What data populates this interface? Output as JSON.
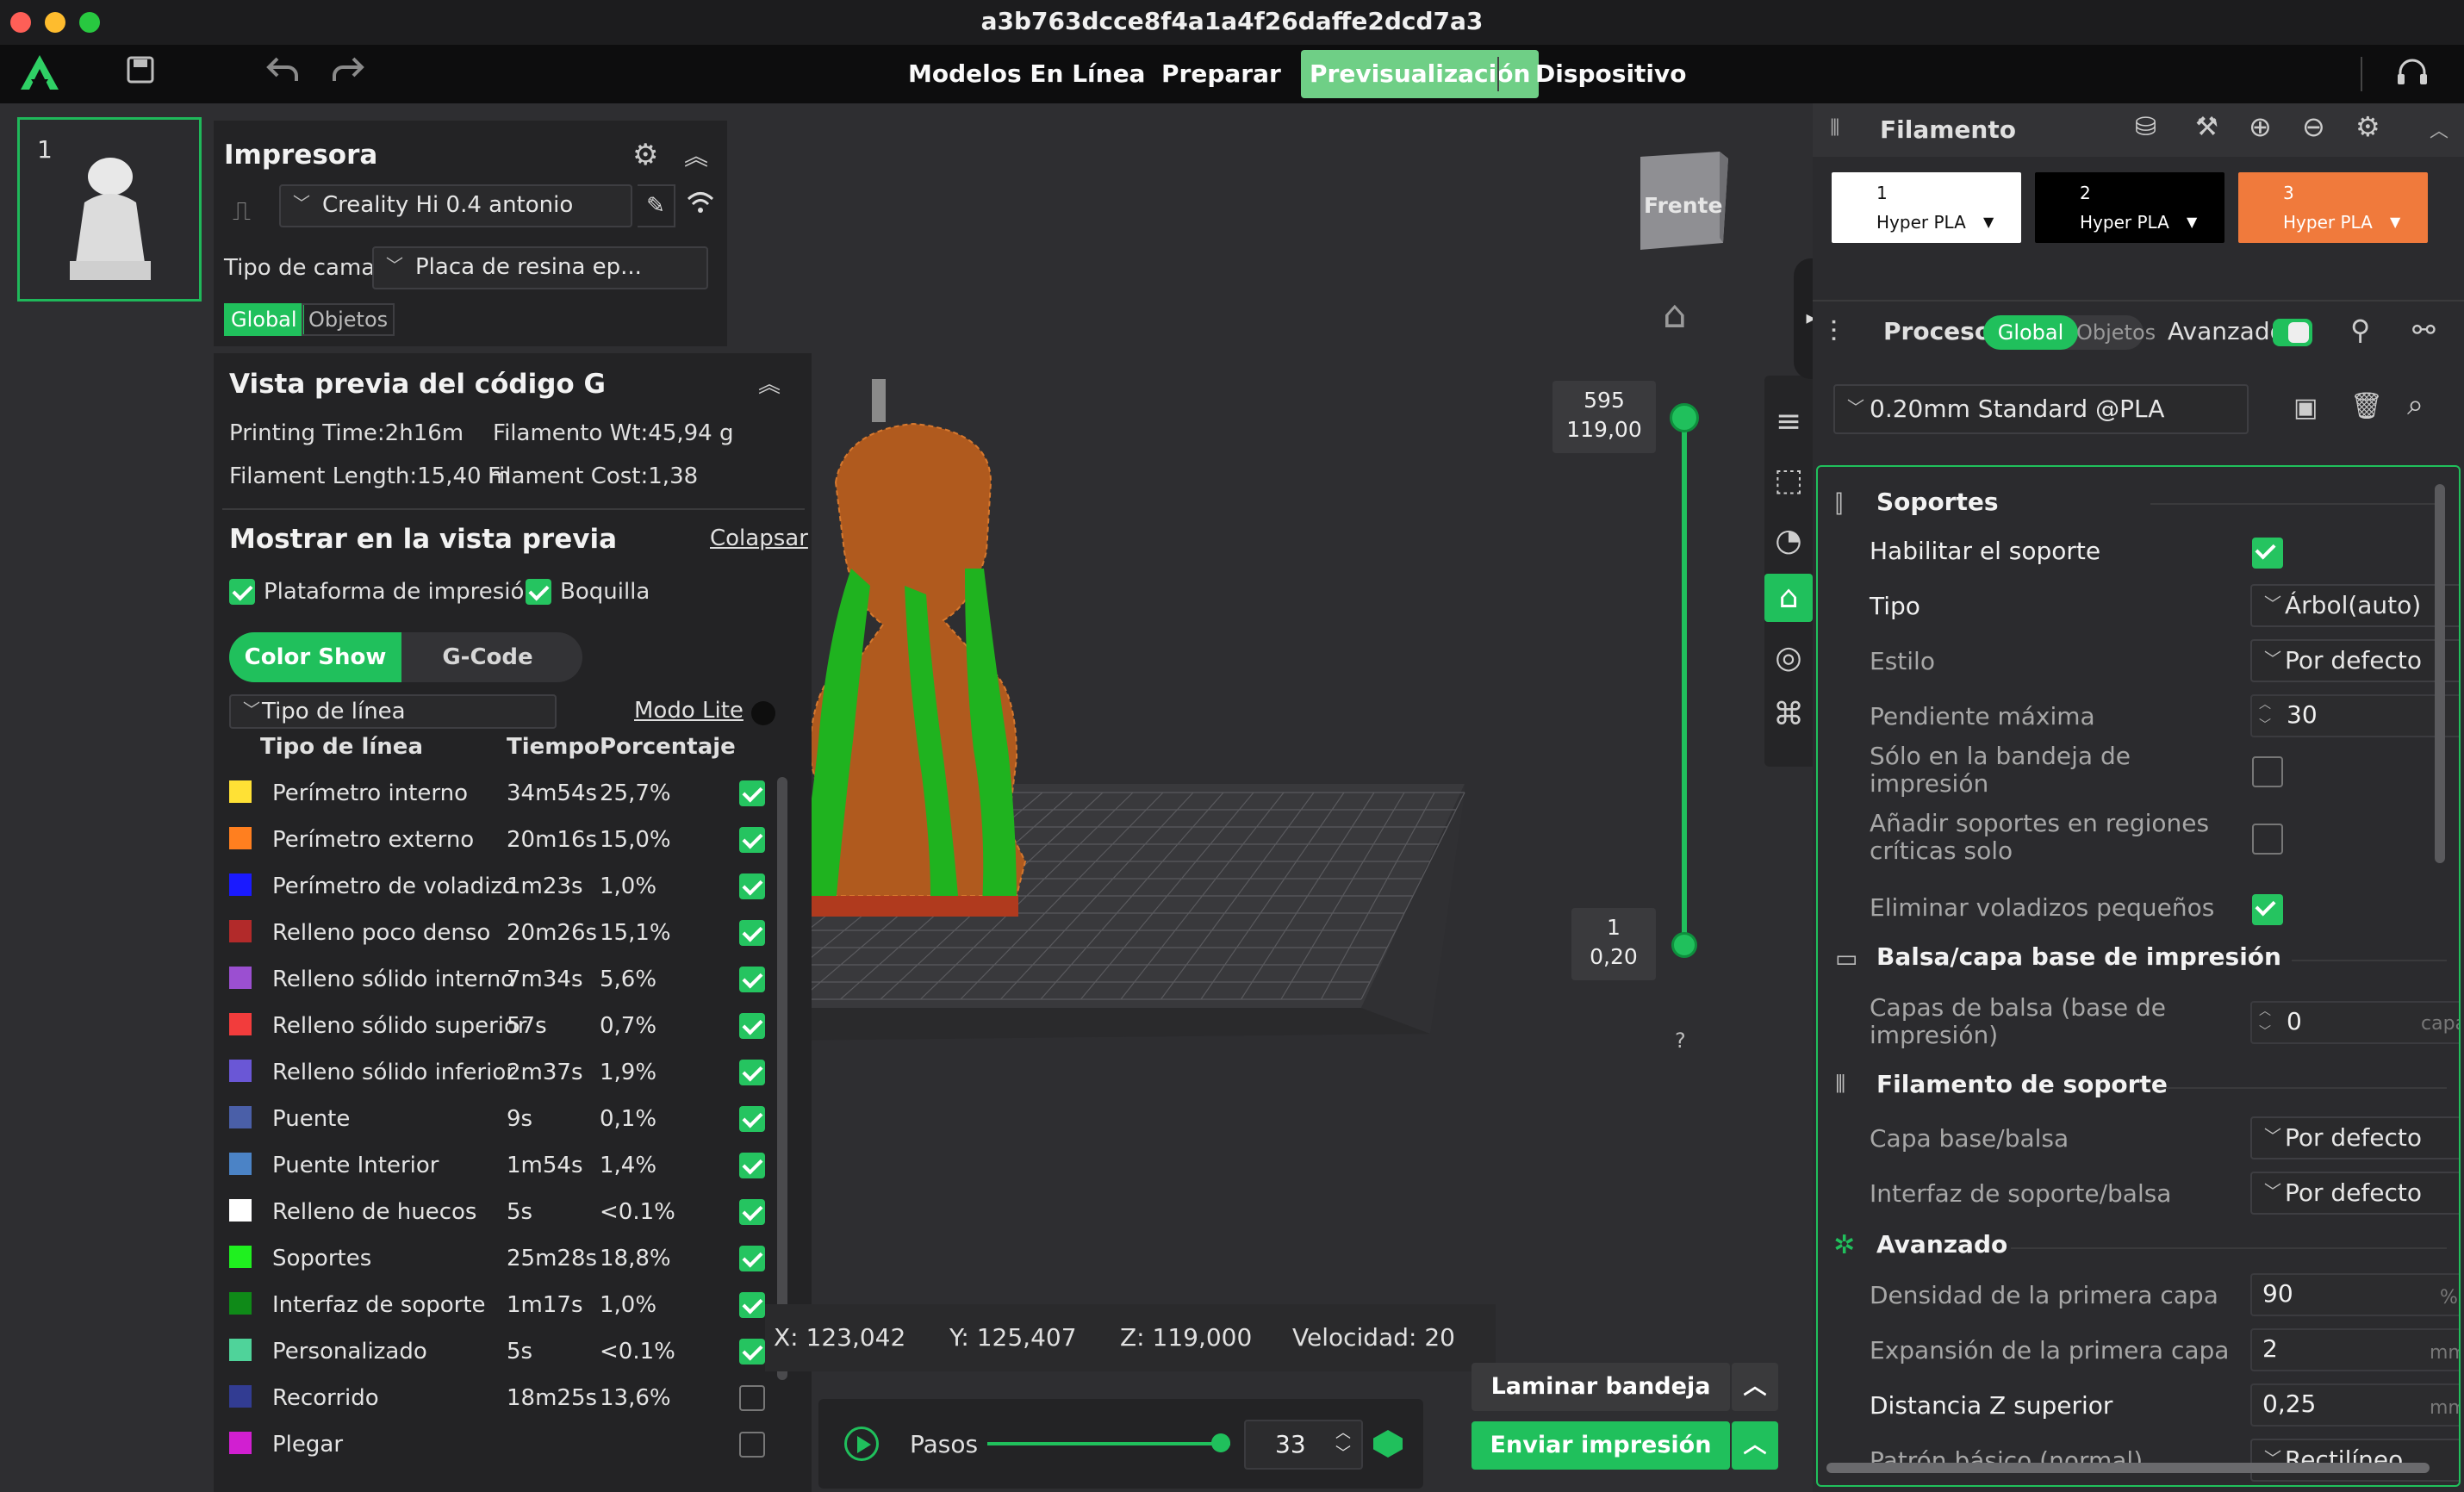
{
  "window": {
    "title": "a3b763dcce8f4a1a4f26daffe2dcd7a3"
  },
  "toolbar": {
    "tabs": [
      "Modelos En Línea",
      "Preparar",
      "Previsualización",
      "Dispositivo"
    ],
    "active_tab": "Previsualización"
  },
  "plates": [
    {
      "number": "1"
    }
  ],
  "printer": {
    "title": "Impresora",
    "name": "Creality Hi 0.4 antonio",
    "bed_label": "Tipo de cama",
    "bed_value": "Placa de resina ep...",
    "scope_tabs": [
      "Global",
      "Objetos"
    ]
  },
  "gcode": {
    "title": "Vista previa del código G",
    "printing_time": "Printing Time:2h16m",
    "filament_wt": "Filamento Wt:45,94 g",
    "filament_length": "Filament Length:15,40 m",
    "filament_cost": "Filament Cost:1,38",
    "show_title": "Mostrar en la vista previa",
    "collapse": "Colapsar",
    "show_bed": "Plataforma de impresión",
    "show_nozzle": "Boquilla",
    "mode_tabs": [
      "Color Show",
      "G-Code"
    ],
    "line_type_combo": "Tipo de línea",
    "lite_mode": "Modo Lite",
    "columns": [
      "Tipo de línea",
      "Tiempo",
      "Porcentaje"
    ],
    "rows": [
      {
        "color": "#ffe135",
        "name": "Perímetro interno",
        "time": "34m54s",
        "pct": "25,7%",
        "on": true
      },
      {
        "color": "#ff7f1f",
        "name": "Perímetro externo",
        "time": "20m16s",
        "pct": "15,0%",
        "on": true
      },
      {
        "color": "#1a1aff",
        "name": "Perímetro de voladizo",
        "time": "1m23s",
        "pct": "1,0%",
        "on": true
      },
      {
        "color": "#b22a2a",
        "name": "Relleno poco denso",
        "time": "20m26s",
        "pct": "15,1%",
        "on": true
      },
      {
        "color": "#9b4fd1",
        "name": "Relleno sólido interno",
        "time": "7m34s",
        "pct": "5,6%",
        "on": true
      },
      {
        "color": "#f23c3c",
        "name": "Relleno sólido superior",
        "time": "57s",
        "pct": "0,7%",
        "on": true
      },
      {
        "color": "#6a57d6",
        "name": "Relleno sólido inferior",
        "time": "2m37s",
        "pct": "1,9%",
        "on": true
      },
      {
        "color": "#4a5fa8",
        "name": "Puente",
        "time": "9s",
        "pct": "0,1%",
        "on": true
      },
      {
        "color": "#4b83c6",
        "name": "Puente Interior",
        "time": "1m54s",
        "pct": "1,4%",
        "on": true
      },
      {
        "color": "#ffffff",
        "name": "Relleno de huecos",
        "time": "5s",
        "pct": "<0.1%",
        "on": true
      },
      {
        "color": "#1ff01f",
        "name": "Soportes",
        "time": "25m28s",
        "pct": "18,8%",
        "on": true
      },
      {
        "color": "#0f8a18",
        "name": "Interfaz de soporte",
        "time": "1m17s",
        "pct": "1,0%",
        "on": true
      },
      {
        "color": "#4fd39a",
        "name": "Personalizado",
        "time": "5s",
        "pct": "<0.1%",
        "on": true
      },
      {
        "color": "#323c92",
        "name": "Recorrido",
        "time": "18m25s",
        "pct": "13,6%",
        "on": false
      },
      {
        "color": "#d11fd1",
        "name": "Plegar",
        "time": "",
        "pct": "",
        "on": false
      }
    ]
  },
  "viewcube": {
    "label": "Frente"
  },
  "layer_slider": {
    "top_layer": "595",
    "top_height": "119,00",
    "bottom_layer": "1",
    "bottom_height": "0,20",
    "help": "?"
  },
  "status": {
    "x": "X: 123,042",
    "y": "Y: 125,407",
    "z": "Z: 119,000",
    "speed": "Velocidad: 20"
  },
  "playback": {
    "label": "Pasos",
    "value": "33"
  },
  "buttons": {
    "slice": "Laminar bandeja",
    "send": "Enviar impresión"
  },
  "filament": {
    "title": "Filamento",
    "slots": [
      {
        "num": "1",
        "type": "Hyper PLA",
        "bg": "#ffffff",
        "fg": "#111111"
      },
      {
        "num": "2",
        "type": "Hyper PLA",
        "bg": "#000000",
        "fg": "#ffffff"
      },
      {
        "num": "3",
        "type": "Hyper PLA",
        "bg": "#f07a3c",
        "fg": "#ffffff"
      }
    ]
  },
  "process": {
    "title": "Proceso",
    "tabs": [
      "Global",
      "Objetos"
    ],
    "advanced": "Avanzado",
    "preset": "0.20mm Standard @PLA"
  },
  "settings": {
    "supports_title": "Soportes",
    "enable_support": "Habilitar el soporte",
    "type_label": "Tipo",
    "type_value": "Árbol(auto)",
    "style_label": "Estilo",
    "style_value": "Por defecto",
    "max_slope_label": "Pendiente máxima",
    "max_slope_value": "30",
    "only_bed_label": "Sólo en la bandeja de impresión",
    "critical_label": "Añadir soportes en regiones críticas solo",
    "remove_small_label": "Eliminar voladizos pequeños",
    "raft_title": "Balsa/capa base de impresión",
    "raft_layers_label": "Capas de balsa (base de impresión)",
    "raft_layers_value": "0",
    "raft_layers_unit": "capa",
    "filament_support_title": "Filamento de soporte",
    "base_raft_label": "Capa base/balsa",
    "base_raft_value": "Por defecto",
    "interface_label": "Interfaz de soporte/balsa",
    "interface_value": "Por defecto",
    "advanced_title": "Avanzado",
    "first_layer_density_label": "Densidad de la primera capa",
    "first_layer_density_value": "90",
    "first_layer_density_unit": "%",
    "first_layer_expansion_label": "Expansión de la primera capa",
    "first_layer_expansion_value": "2",
    "first_layer_expansion_unit": "mm",
    "top_z_label": "Distancia Z superior",
    "top_z_value": "0,25",
    "top_z_unit": "mm",
    "base_pattern_label": "Patrón básico (normal)",
    "base_pattern_value": "Rectilíneo"
  },
  "colors": {
    "accent": "#20c05c",
    "active_tab": "#6fcf86"
  }
}
